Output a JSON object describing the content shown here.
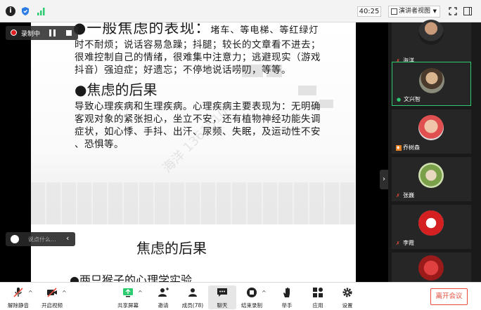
{
  "top_bar": {
    "time": "40:25",
    "view_label": "演讲者视图"
  },
  "recording": {
    "label": "录制中"
  },
  "slide": {
    "heading1_bullet": "●",
    "heading1_main": "一般焦虑的表现：",
    "heading1_rest": "堵车、等电梯、等红绿灯",
    "lines_a": [
      "时不耐烦；说话容易急躁；抖腿；较长的文章看不进去；",
      "很难控制自己的情绪，很难集中注意力；逃避现实（游戏",
      "抖音）强迫症；好遗忘；不停地说话唠叨，等等。"
    ],
    "heading2": "●焦虑的后果",
    "lines_b": [
      "导致心理疾病和生理疾病。心理疾病主要表现为：无明确",
      "客观对象的紧张担心，坐立不安，还有植物神经功能失调",
      "症状，如心悸、手抖、出汗、尿频、失眠，及运动性不安",
      "、恐惧等。"
    ],
    "sub_title": "焦虑的后果",
    "monkey_line": "●两只猴子的心理学实验",
    "watermark": "海洋 13615104"
  },
  "chat_input": {
    "placeholder": "说点什么..."
  },
  "gallery": {
    "participants": [
      {
        "name": "海洋"
      },
      {
        "name": "文兴智"
      },
      {
        "name": "乔树森"
      },
      {
        "name": "张巍"
      },
      {
        "name": "李霞"
      },
      {
        "name": ""
      }
    ]
  },
  "toolbar": {
    "unmute": "解除静音",
    "video": "开启视频",
    "share": "共享屏幕",
    "invite": "邀请",
    "members": "成员(78)",
    "chat": "聊天",
    "end_record": "结束录制",
    "raise_hand": "举手",
    "apps": "应用",
    "settings": "设置",
    "leave": "离开会议"
  }
}
